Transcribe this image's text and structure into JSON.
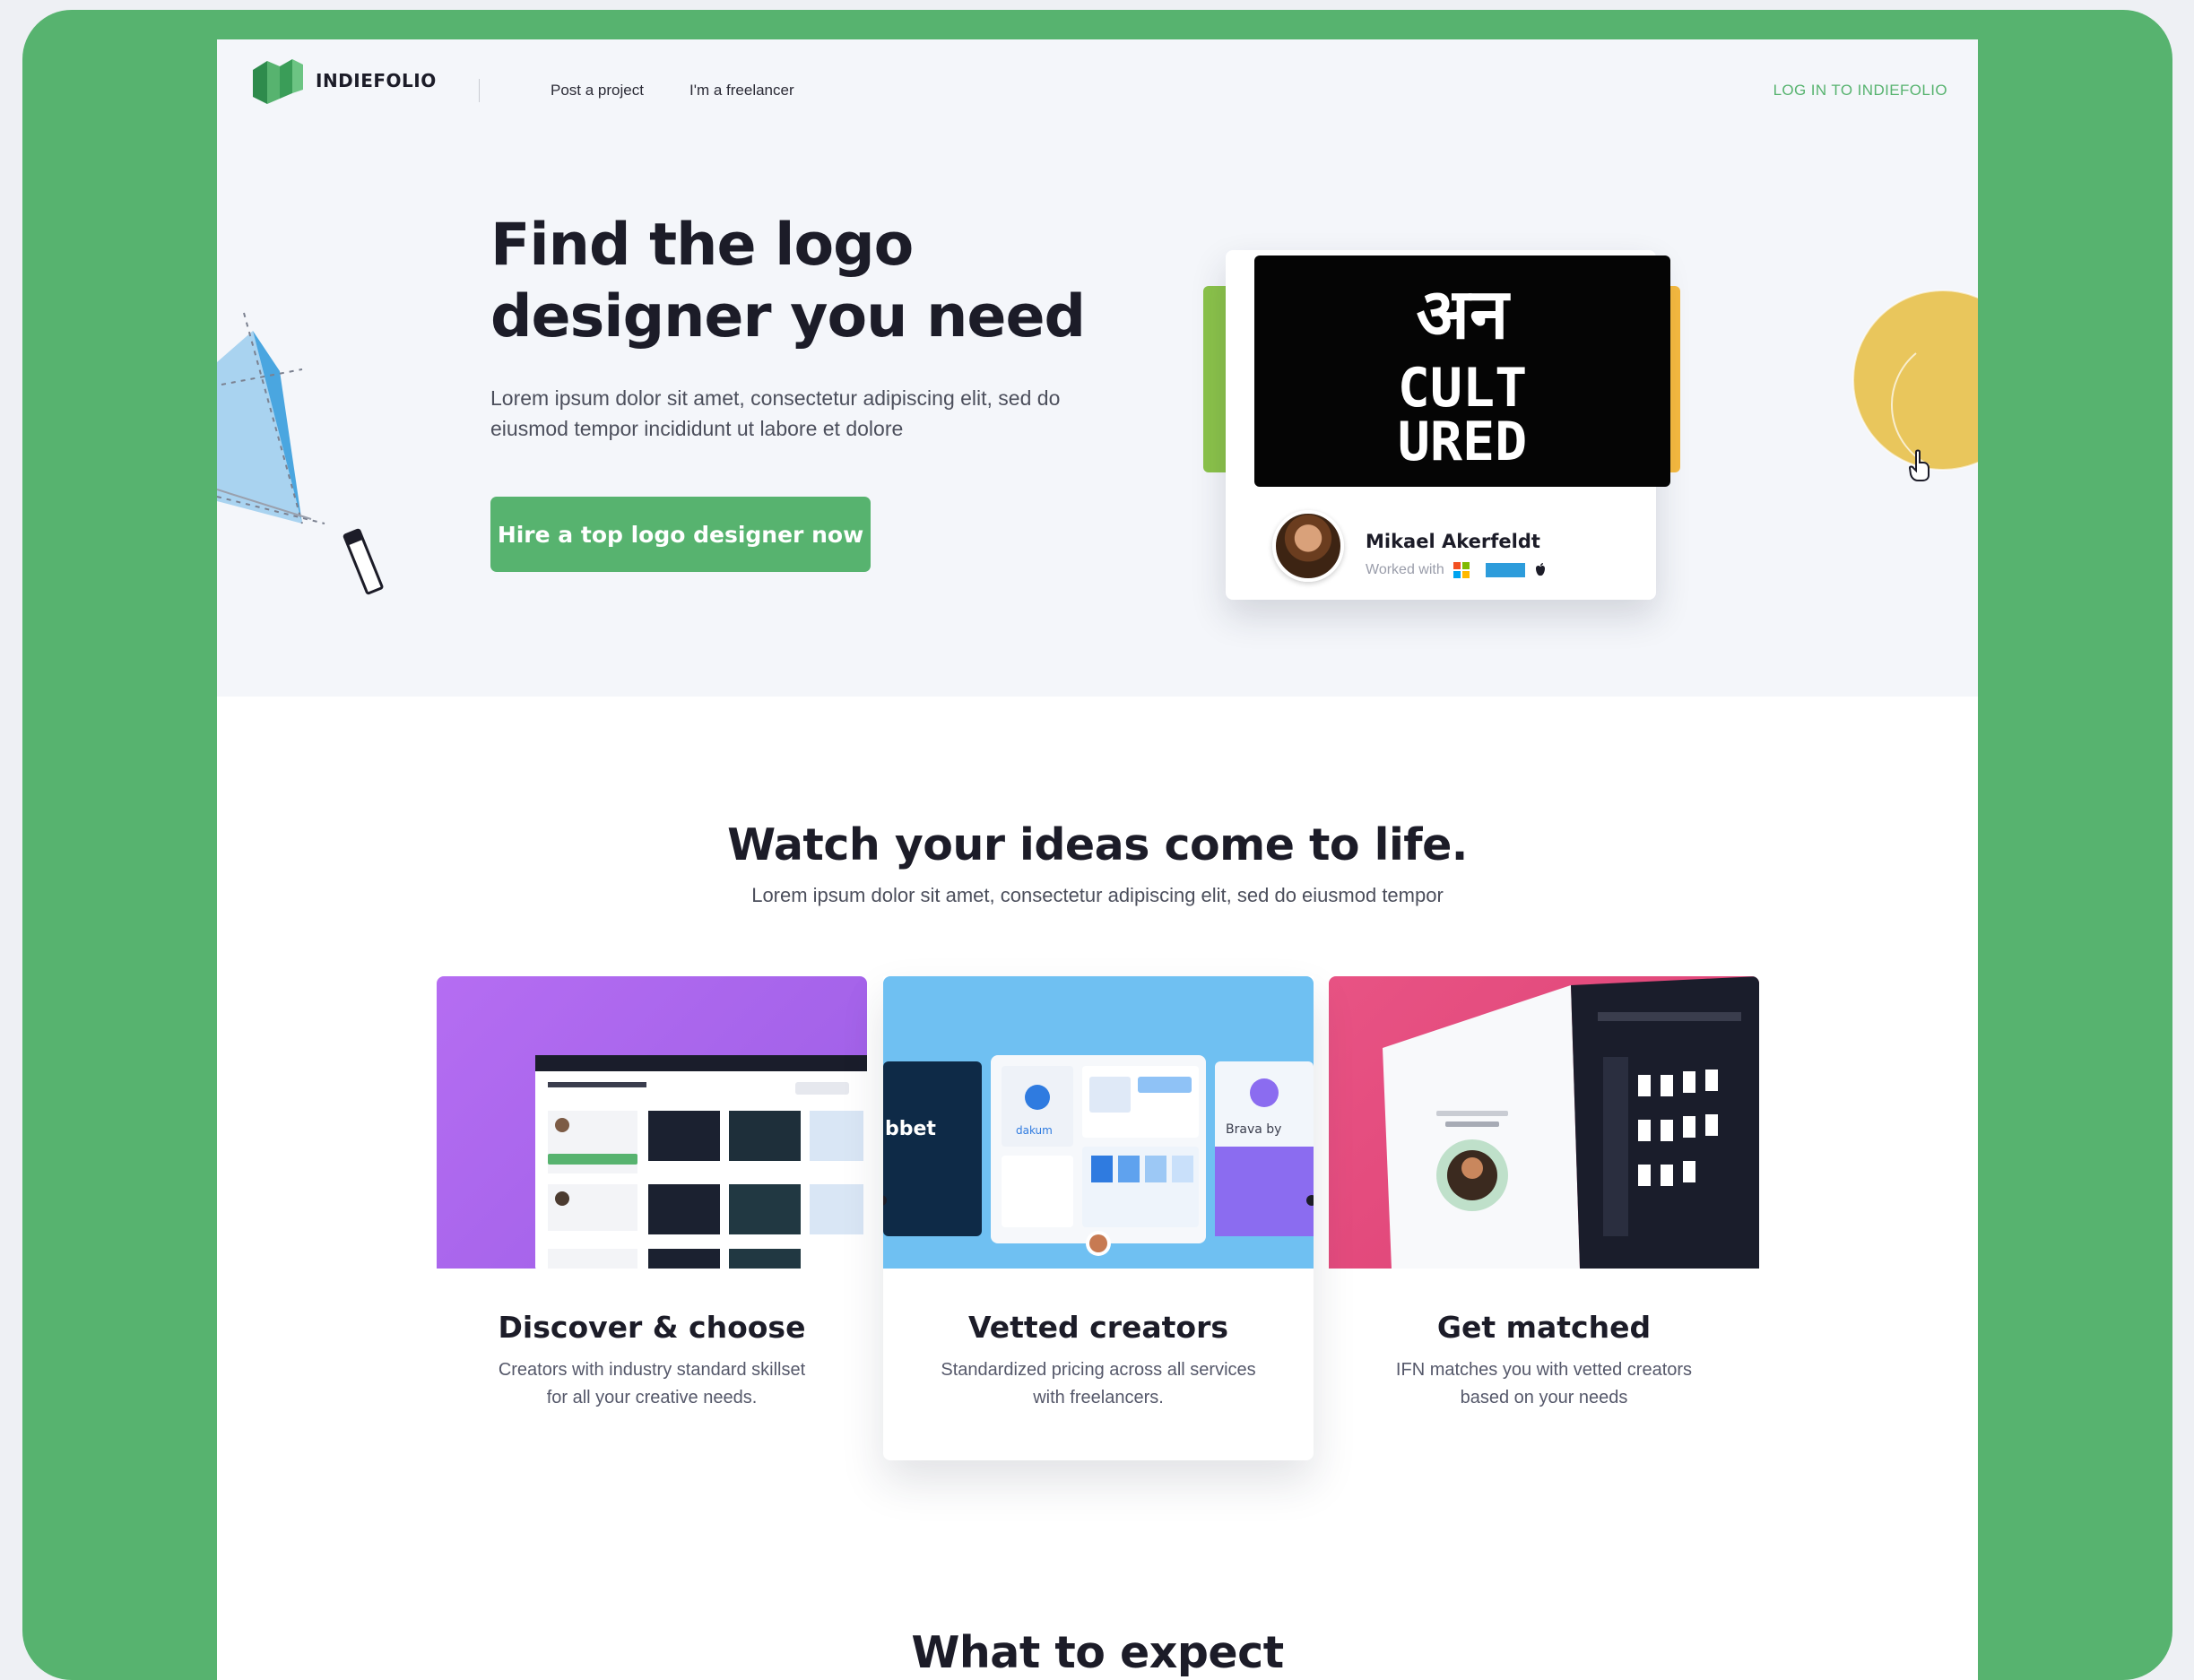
{
  "nav": {
    "brand": "INDIEFOLIO",
    "links": [
      "Post a project",
      "I'm a freelancer"
    ],
    "login": "LOG IN TO INDIEFOLIO"
  },
  "hero": {
    "title_line1": "Find the logo",
    "title_line2": "designer you need",
    "subtitle": "Lorem ipsum dolor sit amet, consectetur adipiscing elit, sed do eiusmod tempor incididunt ut labore et dolore",
    "cta": "Hire a top logo designer now",
    "card": {
      "artwork_text_top": "अन",
      "artwork_text_mid": "CULT",
      "artwork_text_bottom": "URED",
      "designer_name": "Mikael Akerfeldt",
      "worked_with_label": "Worked with",
      "client_icons": [
        "windows-icon",
        "client-logo-icon",
        "apple-icon"
      ]
    }
  },
  "section_ideas": {
    "title": "Watch your ideas come to life.",
    "subtitle": "Lorem ipsum dolor sit amet, consectetur adipiscing elit, sed do eiusmod tempor",
    "features": [
      {
        "title": "Discover & choose",
        "desc": "Creators with industry standard skillset for all your creative needs."
      },
      {
        "title": "Vetted creators",
        "desc": "Standardized pricing across all services with freelancers."
      },
      {
        "title": "Get matched",
        "desc": "IFN matches you with vetted creators based on your needs"
      }
    ],
    "mock_labels": {
      "bet": "bbet",
      "dakum": "dakum",
      "brand": "Brava by"
    }
  },
  "section_expect": {
    "title": "What to expect"
  },
  "colors": {
    "brand_green": "#57b36f",
    "page_bg": "#eef0f4",
    "hero_bg": "#f4f6fa",
    "purple": "#b26cf0",
    "sky": "#6fc0f2",
    "pink": "#e3487a"
  }
}
